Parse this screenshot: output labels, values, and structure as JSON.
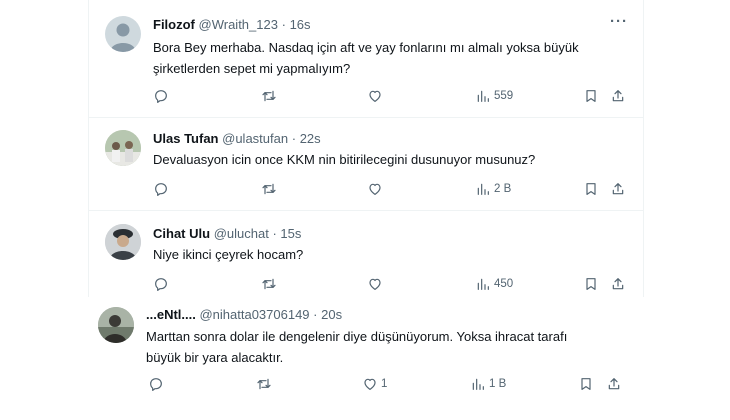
{
  "tweets": [
    {
      "name": "Filozof",
      "handle": "@Wraith_123",
      "sep": "·",
      "time": "16s",
      "text_lines": [
        "Bora Bey merhaba. Nasdaq için aft ve yay fonlarını mı almalı yoksa büyük",
        "şirketlerden sepet mi yapmalıyım?"
      ],
      "likes": "",
      "views": "559",
      "avatar": "default-avatar"
    },
    {
      "name": "Ulas Tufan",
      "handle": "@ulastufan",
      "sep": "·",
      "time": "22s",
      "text_lines": [
        "Devaluasyon icin once KKM nin bitirilecegini dusunuyor musunuz?"
      ],
      "likes": "",
      "views": "2 B",
      "avatar": "group-photo-avatar"
    },
    {
      "name": "Cihat Ulu",
      "handle": "@uluchat",
      "sep": "·",
      "time": "15s",
      "text_lines": [
        "Niye ikinci çeyrek hocam?"
      ],
      "likes": "",
      "views": "450",
      "avatar": "uniform-portrait-avatar"
    },
    {
      "name": "...eNtl....",
      "handle": "@nihatta03706149",
      "sep": "·",
      "time": "20s",
      "text_lines": [
        "Marttan sonra dolar ile dengelenir diye düşünüyorum. Yoksa ihracat tarafı",
        "büyük bir yara alacaktır."
      ],
      "likes": "1",
      "views": "1 B",
      "avatar": "outdoor-portrait-avatar"
    }
  ],
  "icons": [
    "reply-icon",
    "retweet-icon",
    "like-icon",
    "views-icon",
    "bookmark-icon",
    "share-icon",
    "more-icon"
  ],
  "colors": {
    "text": "#0f1419",
    "secondary": "#536471",
    "divider": "#eff3f4"
  }
}
